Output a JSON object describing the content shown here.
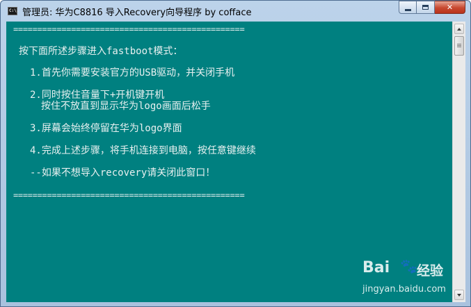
{
  "window": {
    "title": "管理员:  华为C8816 导入Recovery向导程序 by cofface",
    "title_icon_text": "C:\\."
  },
  "console": {
    "separator_top": "================================================",
    "intro": "按下面所述步骤进入fastboot模式：",
    "step1": "1.首先你需要安装官方的USB驱动，并关闭手机",
    "step2_line1": "2.同时按住音量下+开机键开机",
    "step2_line2": "按住不放直到显示华为logo画面后松手",
    "step3": "3.屏幕会始终停留在华为logo界面",
    "step4": "4.完成上述步骤，将手机连接到电脑，按任意键继续",
    "exit_note": "--如果不想导入recovery请关闭此窗口！",
    "separator_bottom": "================================================"
  },
  "watermark": {
    "logo": "Bai",
    "logo_cn": "经验",
    "url": "jingyan.baidu.com"
  },
  "colors": {
    "console_bg": "#008080",
    "console_text": "#e8f0f0",
    "close_button": "#c7482f"
  }
}
